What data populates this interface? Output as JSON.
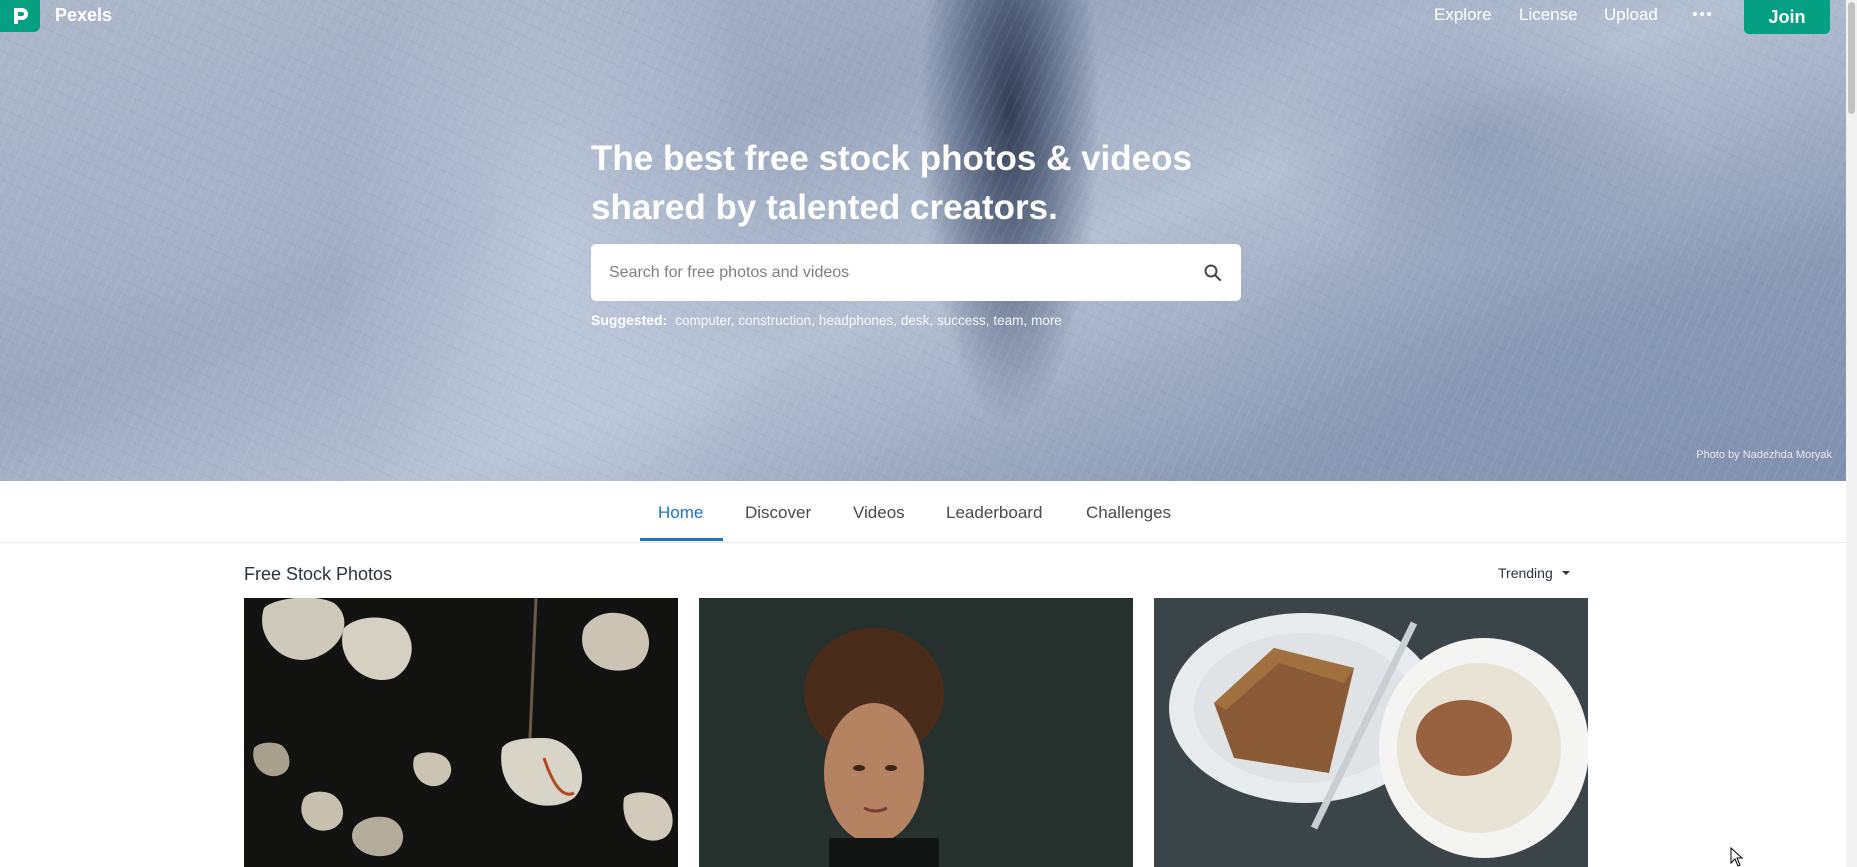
{
  "header": {
    "brand": "Pexels",
    "nav": [
      "Explore",
      "License",
      "Upload"
    ],
    "more_icon": "ellipsis-icon",
    "join_label": "Join",
    "brand_color": "#05a081"
  },
  "hero": {
    "headline_line1": "The best free stock photos & videos",
    "headline_line2": "shared by talented creators.",
    "search_placeholder": "Search for free photos and videos",
    "search_icon": "search-icon",
    "suggested_label": "Suggested:",
    "suggested_tags": [
      "computer,",
      "construction,",
      "headphones,",
      "desk,",
      "success,",
      "team,",
      "more"
    ],
    "credit": "Photo by Nadezhda Moryak"
  },
  "tabs": {
    "items": [
      "Home",
      "Discover",
      "Videos",
      "Leaderboard",
      "Challenges"
    ],
    "active": "Home",
    "active_color": "#1a73c9"
  },
  "content": {
    "section_title": "Free Stock Photos",
    "sort_label": "Trending",
    "photos": [
      "flowers-photo",
      "portrait-photo",
      "coffee-cake-photo"
    ]
  }
}
